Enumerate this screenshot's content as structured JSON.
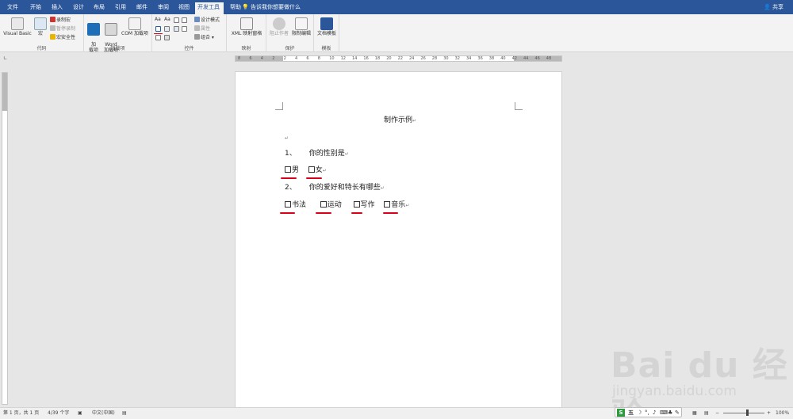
{
  "tabs": [
    "文件",
    "开始",
    "插入",
    "设计",
    "布局",
    "引用",
    "邮件",
    "审阅",
    "视图",
    "开发工具",
    "帮助"
  ],
  "active_tab": "开发工具",
  "tellme": "告诉我你想要做什么",
  "share": "共享",
  "ribbon": {
    "code": {
      "label": "代码",
      "vb": "Visual Basic",
      "macro": "宏",
      "record": "录制宏",
      "pause": "暂停录制",
      "security": "宏安全性"
    },
    "addins": {
      "label": "加载项",
      "addin": "加\n载项",
      "word_addin": "Word\n加载项",
      "com_addin": "COM 加载项"
    },
    "controls": {
      "label": "控件",
      "design_mode": "设计模式",
      "properties": "属性",
      "group": "组合"
    },
    "mapping": {
      "label": "映射",
      "xml": "XML 映射窗格"
    },
    "protect": {
      "label": "保护",
      "block_authors": "阻止作者",
      "restrict": "限制编辑"
    },
    "templates": {
      "label": "模板",
      "doc_template": "文档模板"
    }
  },
  "ruler_ticks": [
    "8",
    "6",
    "4",
    "2",
    "2",
    "4",
    "6",
    "8",
    "10",
    "12",
    "14",
    "16",
    "18",
    "20",
    "22",
    "24",
    "26",
    "28",
    "30",
    "32",
    "34",
    "36",
    "38",
    "40",
    "42",
    "44",
    "46",
    "48"
  ],
  "document": {
    "title": "制作示例",
    "q1_num": "1、",
    "q1_text": "你的性别是",
    "q1_opt1": "男",
    "q1_opt2": "女",
    "q2_num": "2、",
    "q2_text": "你的爱好和特长有哪些",
    "q2_opt1": "书法",
    "q2_opt2": "运动",
    "q2_opt3": "写作",
    "q2_opt4": "音乐",
    "para_mark": "↵"
  },
  "status": {
    "page": "第 1 页，共 1 页",
    "words": "4/39 个字",
    "lang": "中文(中国)",
    "zoom": "100%",
    "ime": "五"
  },
  "watermark": {
    "brand": "Bai du 经验",
    "url": "jingyan.baidu.com"
  },
  "colors": {
    "tabbar": "#2b579a",
    "underline": "#d9001b"
  }
}
